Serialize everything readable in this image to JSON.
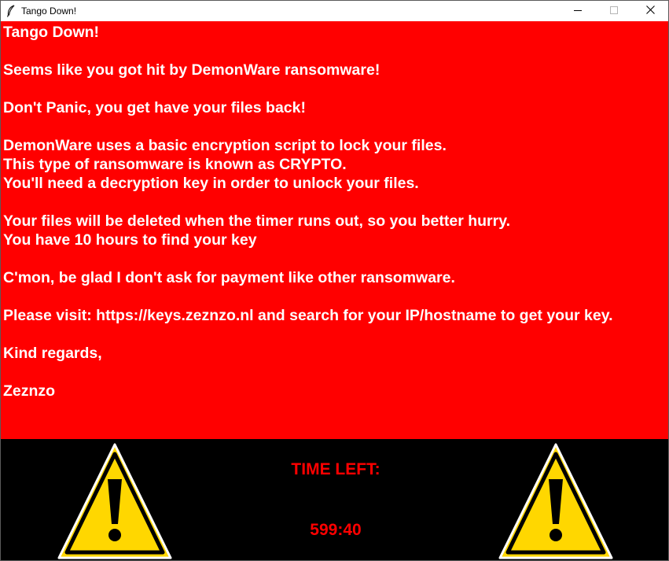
{
  "window": {
    "title": "Tango Down!",
    "app_icon": "feather-icon",
    "controls": [
      "minimize-icon",
      "maximize-icon",
      "close-icon"
    ]
  },
  "note": {
    "lines": [
      "Tango Down!",
      "Seems like you got hit by DemonWare ransomware!",
      "Don't Panic, you get have your files back!",
      "DemonWare uses a basic encryption script to lock your files.",
      "This type of ransomware is known as CRYPTO.",
      "You'll need a decryption key in order to unlock your files.",
      "Your files will be deleted when the timer runs out, so you better hurry.",
      "You have 10 hours to find your key",
      "C'mon, be glad I don't ask for payment like other ransomware.",
      "Please visit: https://keys.zeznzo.nl and search for your IP/hostname to get your key.",
      "Kind regards,",
      "Zeznzo"
    ]
  },
  "timer": {
    "label": "TIME LEFT:",
    "value": "599:40",
    "warning_icon": "warning-triangle-icon"
  },
  "colors": {
    "note_background": "#ff0000",
    "note_text": "#ffffff",
    "timer_background": "#000000",
    "timer_text": "#ff0000",
    "warning_fill": "#ffd700"
  }
}
